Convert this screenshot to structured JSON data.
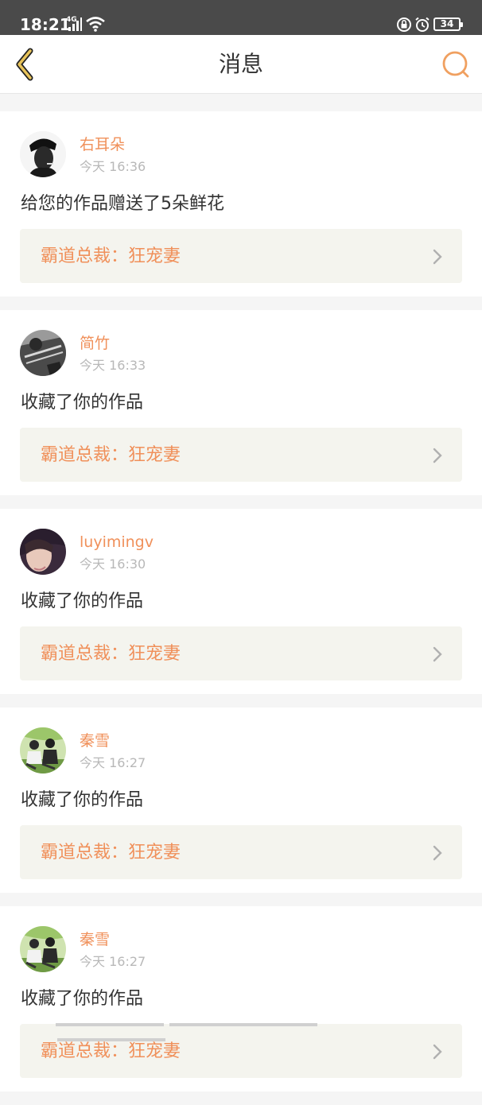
{
  "status_bar": {
    "time": "18:21",
    "network": "4G",
    "battery": "34",
    "icons": [
      "signal-icon",
      "wifi-icon",
      "lock-rotation-icon",
      "alarm-icon",
      "battery-icon"
    ]
  },
  "nav": {
    "title": "消息",
    "back_icon": "chevron-left-icon",
    "search_icon": "search-icon",
    "accent_color": "#f0a060"
  },
  "messages": [
    {
      "username": "右耳朵",
      "time": "今天 16:36",
      "text": "给您的作品赠送了5朵鲜花",
      "work": "霸道总裁：狂宠妻"
    },
    {
      "username": "简竹",
      "time": "今天 16:33",
      "text": "收藏了你的作品",
      "work": "霸道总裁：狂宠妻"
    },
    {
      "username": "luyimingv",
      "time": "今天 16:30",
      "text": "收藏了你的作品",
      "work": "霸道总裁：狂宠妻"
    },
    {
      "username": "秦雪",
      "time": "今天 16:27",
      "text": "收藏了你的作品",
      "work": "霸道总裁：狂宠妻"
    },
    {
      "username": "秦雪",
      "time": "今天 16:27",
      "text": "收藏了你的作品",
      "work": "霸道总裁：狂宠妻"
    }
  ],
  "colors": {
    "username": "#f0905a",
    "work_title": "#f0905a",
    "time": "#b8b8b8",
    "message": "#333333",
    "work_bg": "#f4f4ee"
  }
}
